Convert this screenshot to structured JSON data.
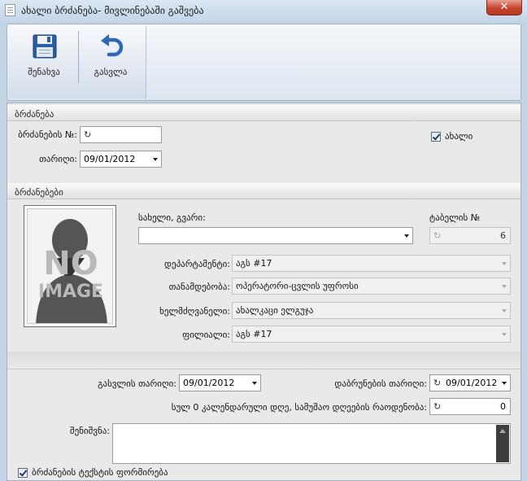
{
  "window": {
    "title": "ახალი ბრძანება- მივლინებაში გაშვება",
    "close_glyph": "✕"
  },
  "toolbar": {
    "save_label": "შენახვა",
    "exit_label": "გასვლა"
  },
  "order": {
    "section_title": "ბრძანება",
    "number_label": "ბრძანების №:",
    "number_value": "",
    "date_label": "თარიღი:",
    "date_value": "09/01/2012",
    "new_checkbox_label": "ახალი",
    "new_checked": true
  },
  "orders": {
    "section_title": "ბრძანებები",
    "photo_text_line1": "NO",
    "photo_text_line2": "IMAGE",
    "name_label": "სახელი, გვარი:",
    "name_value": "",
    "tabel_label": "ტაბელის №",
    "tabel_value": "6",
    "department_label": "დეპარტამენტი:",
    "department_value": "აგს #17",
    "position_label": "თანამდებობა:",
    "position_value": "ოპერატორი-ცვლის უფროსი",
    "manager_label": "ხელმძღვანელი:",
    "manager_value": "ახალკაცი ელგუჯა",
    "branch_label": "ფილიალი:",
    "branch_value": "აგს #17"
  },
  "trip": {
    "departure_label": "გასვლის თარიღი:",
    "departure_value": "09/01/2012",
    "return_label": "დაბრუნების თარიღი:",
    "return_value": "09/01/2012",
    "workdays_label": "სულ 0 კალენდარული დღე, სამუშაო დღეების რაოდენობა:",
    "workdays_value": "0",
    "notes_label": "შენიშვნა:",
    "notes_value": ""
  },
  "footer": {
    "format_checkbox_label": "ბრძანების ტექსტის ფორმირება",
    "format_checked": true
  },
  "icons": {
    "save": "floppy-disk-icon",
    "exit": "undo-arrow-icon",
    "cycle": "cycle-arrow-icon"
  },
  "colors": {
    "accent": "#2c69b7",
    "close": "#c9452e"
  }
}
